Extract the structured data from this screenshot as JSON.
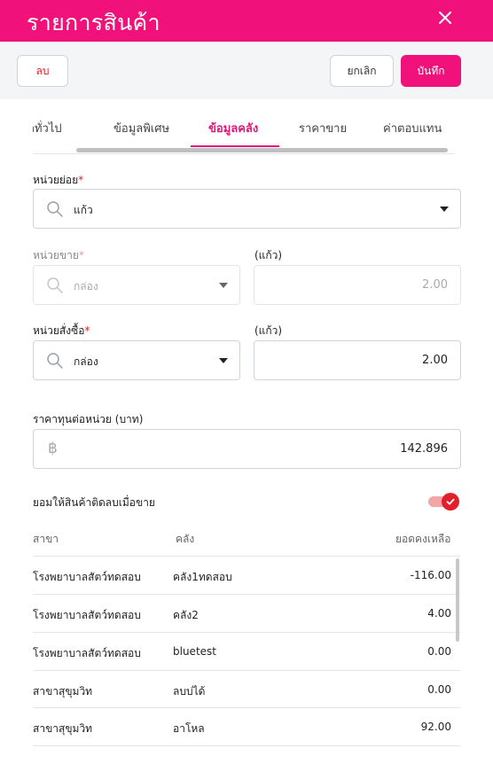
{
  "header": {
    "title": "รายการสินค้า",
    "close_icon": "close-icon"
  },
  "actions": {
    "delete_label": "ลบ",
    "cancel_label": "ยกเลิก",
    "save_label": "บันทึก"
  },
  "tabs": [
    {
      "label": "ลทั่วไป",
      "active": false
    },
    {
      "label": "ข้อมูลพิเศษ",
      "active": false
    },
    {
      "label": "ข้อมูลคลัง",
      "active": true
    },
    {
      "label": "ราคาขาย",
      "active": false
    },
    {
      "label": "ค่าตอบแทน",
      "active": false
    }
  ],
  "form": {
    "sub_unit": {
      "label": "หน่วยย่อย",
      "required_mark": "*",
      "value": "แก้ว",
      "icon": "search-icon"
    },
    "sale_unit": {
      "label": "หน่วยขาย",
      "required_mark": "*",
      "value": "กล่อง",
      "qty_label": "(แก้ว)",
      "qty": "2.00",
      "disabled": true
    },
    "purchase_unit": {
      "label": "หน่วยสั่งซื้อ",
      "required_mark": "*",
      "value": "กล่อง",
      "qty_label": "(แก้ว)",
      "qty": "2.00"
    },
    "cost_price": {
      "label": "ราคาทุนต่อหน่วย (บาท)",
      "currency_symbol": "฿",
      "value": "142.896"
    },
    "allow_negative": {
      "label": "ยอมให้สินค้าติดลบเมื่อขาย",
      "enabled": true
    }
  },
  "stock_table": {
    "columns": [
      "สาขา",
      "คลัง",
      "ยอดคงเหลือ"
    ],
    "rows": [
      {
        "branch": "โรงพยาบาลสัตว์ทดสอบ",
        "warehouse": "คลัง1ทดสอบ",
        "balance": "-116.00"
      },
      {
        "branch": "โรงพยาบาลสัตว์ทดสอบ",
        "warehouse": "คลัง2",
        "balance": "4.00"
      },
      {
        "branch": "โรงพยาบาลสัตว์ทดสอบ",
        "warehouse": "bluetest",
        "balance": "0.00"
      },
      {
        "branch": "สาขาสุขุมวิท",
        "warehouse": "ลบบ่ได้",
        "balance": "0.00"
      },
      {
        "branch": "สาขาสุขุมวิท",
        "warehouse": "อาโหล",
        "balance": "92.00"
      }
    ]
  },
  "colors": {
    "brand": "#f0127a",
    "danger": "#e0212b"
  }
}
